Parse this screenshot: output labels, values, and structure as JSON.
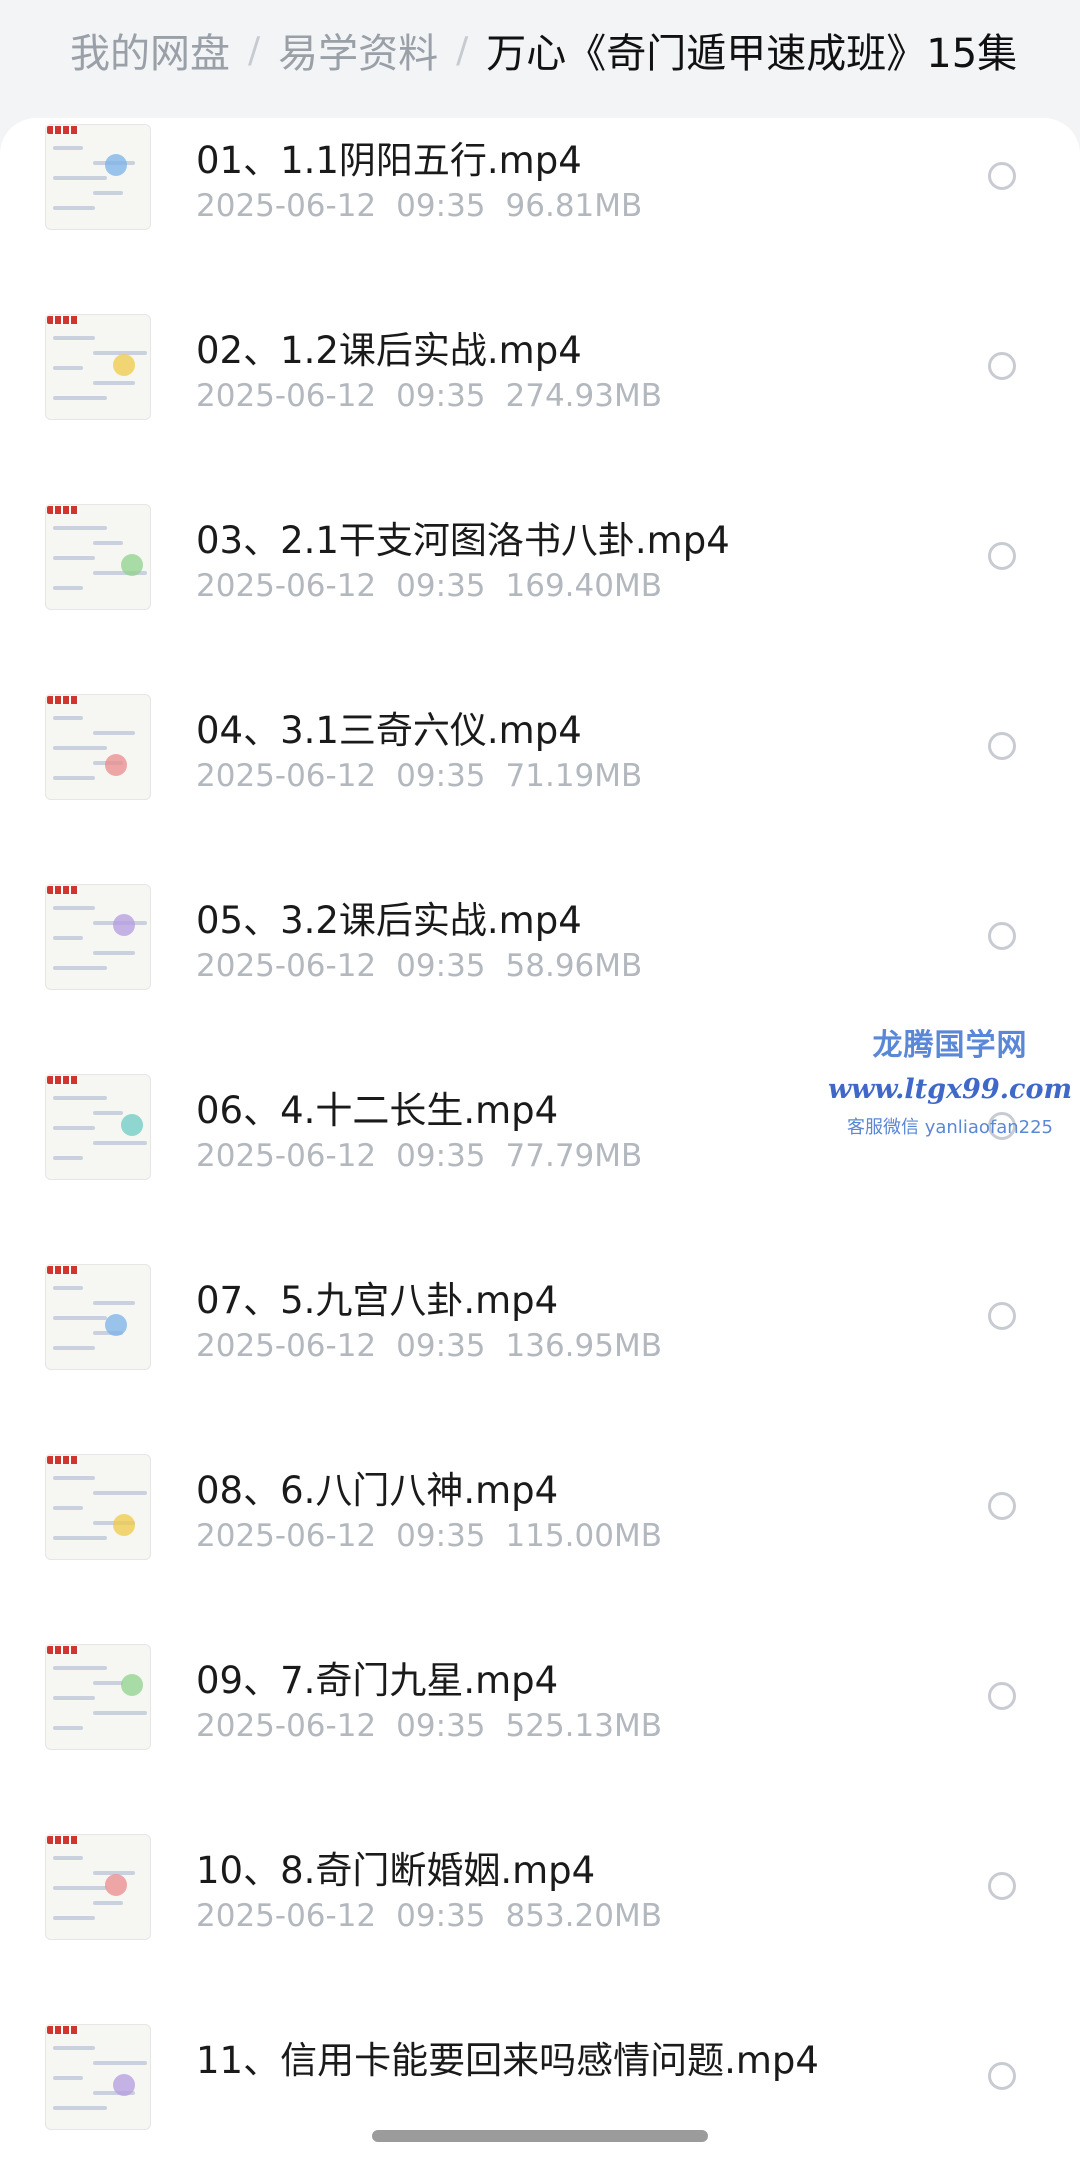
{
  "breadcrumb": [
    {
      "label": "我的网盘"
    },
    {
      "label": "易学资料"
    },
    {
      "label": "万心《奇门遁甲速成班》15集"
    }
  ],
  "breadcrumb_separator": "/",
  "files": [
    {
      "name": "01、1.1阴阳五行.mp4",
      "date": "2025-06-12",
      "time": "09:35",
      "size": "96.81MB"
    },
    {
      "name": "02、1.2课后实战.mp4",
      "date": "2025-06-12",
      "time": "09:35",
      "size": "274.93MB"
    },
    {
      "name": "03、2.1干支河图洛书八卦.mp4",
      "date": "2025-06-12",
      "time": "09:35",
      "size": "169.40MB"
    },
    {
      "name": "04、3.1三奇六仪.mp4",
      "date": "2025-06-12",
      "time": "09:35",
      "size": "71.19MB"
    },
    {
      "name": "05、3.2课后实战.mp4",
      "date": "2025-06-12",
      "time": "09:35",
      "size": "58.96MB"
    },
    {
      "name": "06、4.十二长生.mp4",
      "date": "2025-06-12",
      "time": "09:35",
      "size": "77.79MB"
    },
    {
      "name": "07、5.九宫八卦.mp4",
      "date": "2025-06-12",
      "time": "09:35",
      "size": "136.95MB"
    },
    {
      "name": "08、6.八门八神.mp4",
      "date": "2025-06-12",
      "time": "09:35",
      "size": "115.00MB"
    },
    {
      "name": "09、7.奇门九星.mp4",
      "date": "2025-06-12",
      "time": "09:35",
      "size": "525.13MB"
    },
    {
      "name": "10、8.奇门断婚姻.mp4",
      "date": "2025-06-12",
      "time": "09:35",
      "size": "853.20MB"
    },
    {
      "name": "11、信用卡能要回来吗感情问题.mp4",
      "date": "",
      "time": "",
      "size": ""
    }
  ],
  "watermark": {
    "brand": "龙腾国学网",
    "url": "www.ltgx99.com",
    "contact": "客服微信 yanliaofan225"
  },
  "icons": {
    "file_thumbnail": "video-thumbnail-icon",
    "select": "radio-circle-icon"
  }
}
